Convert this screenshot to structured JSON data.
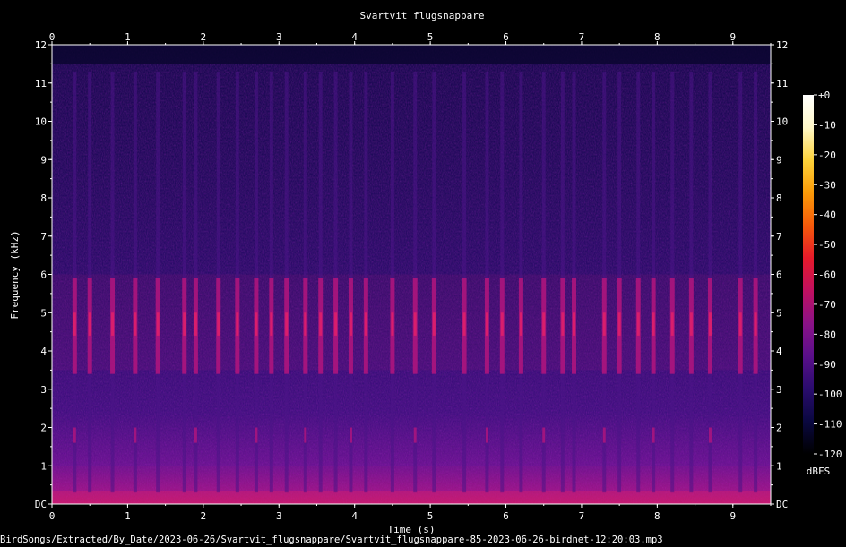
{
  "chart_data": {
    "type": "heatmap",
    "title": "Svartvit flugsnappare",
    "xlabel": "Time (s)",
    "ylabel": "Frequency (kHz)",
    "xlim": [
      0,
      9.5
    ],
    "ylim": [
      0,
      12
    ],
    "x_ticks": [
      "0",
      "1",
      "2",
      "3",
      "4",
      "5",
      "6",
      "7",
      "8",
      "9"
    ],
    "y_ticks": [
      "DC",
      "1",
      "2",
      "3",
      "4",
      "5",
      "6",
      "7",
      "8",
      "9",
      "10",
      "11",
      "12"
    ],
    "colorbar": {
      "unit": "dBFS",
      "range": [
        -120,
        0
      ],
      "ticks": [
        "+0",
        "-10",
        "-20",
        "-30",
        "-40",
        "-50",
        "-60",
        "-70",
        "-80",
        "-90",
        "-100",
        "-110",
        "-120"
      ],
      "colormap": [
        "#000000",
        "#0a0840",
        "#2a0c6e",
        "#5a0f8a",
        "#8a1287",
        "#c01060",
        "#e51a2a",
        "#f55a0a",
        "#fa9a08",
        "#fdd23a",
        "#fff8c8",
        "#ffffff"
      ]
    },
    "notable_bands": [
      {
        "name": "song-harmonic",
        "freq_khz_range": [
          3.5,
          6.0
        ],
        "level_dbfs": -65
      },
      {
        "name": "low-frequency-noise",
        "freq_khz_range": [
          0,
          1.0
        ],
        "level_dbfs": -70
      }
    ],
    "note_onsets_s": [
      0.3,
      0.5,
      0.8,
      1.1,
      1.4,
      1.75,
      1.9,
      2.2,
      2.45,
      2.7,
      2.9,
      3.1,
      3.35,
      3.55,
      3.75,
      3.95,
      4.15,
      4.5,
      4.8,
      5.05,
      5.45,
      5.75,
      5.95,
      6.2,
      6.5,
      6.75,
      6.9,
      7.3,
      7.5,
      7.75,
      7.95,
      8.2,
      8.45,
      8.7,
      9.1,
      9.3
    ]
  },
  "footer_path": "BirdSongs/Extracted/By_Date/2023-06-26/Svartvit_flugsnappare/Svartvit_flugsnappare-85-2023-06-26-birdnet-12:20:03.mp3"
}
